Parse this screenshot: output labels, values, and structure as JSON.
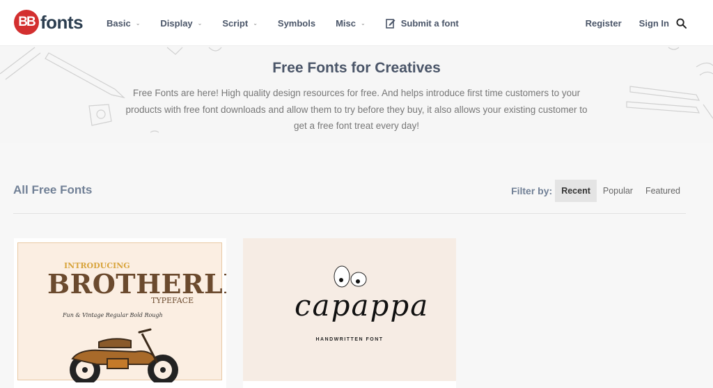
{
  "header": {
    "logo_badge": "BB",
    "logo_text": "fonts",
    "nav": [
      {
        "label": "Basic",
        "dropdown": true
      },
      {
        "label": "Display",
        "dropdown": true
      },
      {
        "label": "Script",
        "dropdown": true
      },
      {
        "label": "Symbols",
        "dropdown": false
      },
      {
        "label": "Misc",
        "dropdown": true
      },
      {
        "label": "Submit a font",
        "dropdown": false
      }
    ],
    "register": "Register",
    "sign_in": "Sign In",
    "chevron": "⌄"
  },
  "hero": {
    "title": "Free Fonts for Creatives",
    "text": "Free Fonts are here! High quality design resources for free. And helps introduce first time customers to your products with free font downloads and allow them to try before they buy, it also allows your existing customer to get a free font treat every day!"
  },
  "section": {
    "title": "All Free Fonts",
    "filter_label": "Filter by:",
    "filters": [
      "Recent",
      "Popular",
      "Featured"
    ],
    "active_filter": "Recent"
  },
  "cards": [
    {
      "intro": "INTRODUCING",
      "name": "BROTHERLEY",
      "sub": "TYPEFACE",
      "tags": "Fun & Vintage   Regular   Bold   Rough"
    },
    {
      "name": "capappa",
      "sub": "HANDWRITTEN FONT"
    }
  ],
  "colors": {
    "brand_red": "#d32f2f",
    "logo_text": "#2c3e50",
    "nav_text": "#4a5568"
  }
}
